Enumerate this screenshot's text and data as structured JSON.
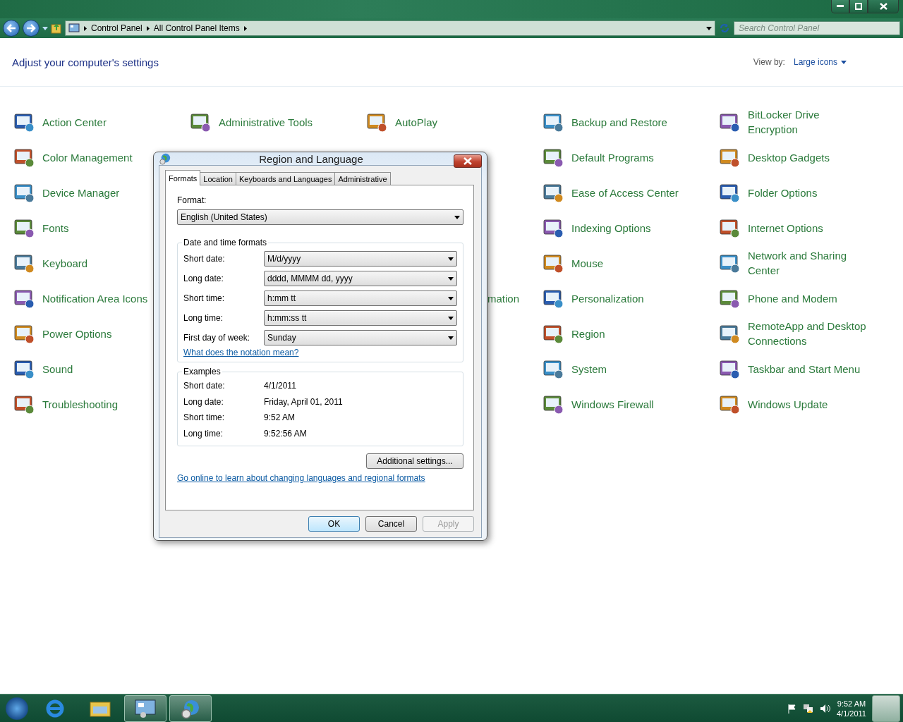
{
  "address_bar": {
    "breadcrumbs": [
      "Control Panel",
      "All Control Panel Items"
    ],
    "search": {
      "placeholder": "Search Control Panel"
    }
  },
  "header": {
    "title": "Adjust your computer's settings",
    "view_by_label": "View by:",
    "view_by_value": "Large icons"
  },
  "items": [
    {
      "kind": "full",
      "label": "Action Center"
    },
    {
      "kind": "full",
      "label": "Administrative Tools"
    },
    {
      "kind": "full",
      "label": "AutoPlay"
    },
    {
      "kind": "full",
      "label": "Backup and Restore"
    },
    {
      "kind": "full",
      "label": "BitLocker Drive Encryption"
    },
    {
      "kind": "full",
      "label": "Color Management"
    },
    {
      "kind": "covered"
    },
    {
      "kind": "covered"
    },
    {
      "kind": "full",
      "label": "Default Programs"
    },
    {
      "kind": "full",
      "label": "Desktop Gadgets"
    },
    {
      "kind": "full",
      "label": "Device Manager"
    },
    {
      "kind": "covered"
    },
    {
      "kind": "covered"
    },
    {
      "kind": "full",
      "label": "Ease of Access Center"
    },
    {
      "kind": "full",
      "label": "Folder Options"
    },
    {
      "kind": "full",
      "label": "Fonts"
    },
    {
      "kind": "covered"
    },
    {
      "kind": "covered"
    },
    {
      "kind": "full",
      "label": "Indexing Options"
    },
    {
      "kind": "full",
      "label": "Internet Options"
    },
    {
      "kind": "full",
      "label": "Keyboard"
    },
    {
      "kind": "covered"
    },
    {
      "kind": "covered"
    },
    {
      "kind": "full",
      "label": "Mouse"
    },
    {
      "kind": "full",
      "label": "Network and Sharing Center"
    },
    {
      "kind": "full",
      "label": "Notification Area Icons"
    },
    {
      "kind": "covered"
    },
    {
      "kind": "cut",
      "label": "mation"
    },
    {
      "kind": "full",
      "label": "Personalization"
    },
    {
      "kind": "full",
      "label": "Phone and Modem"
    },
    {
      "kind": "full",
      "label": "Power Options"
    },
    {
      "kind": "covered"
    },
    {
      "kind": "covered"
    },
    {
      "kind": "full",
      "label": "Region"
    },
    {
      "kind": "full",
      "label": "RemoteApp and Desktop Connections"
    },
    {
      "kind": "full",
      "label": "Sound"
    },
    {
      "kind": "covered"
    },
    {
      "kind": "covered"
    },
    {
      "kind": "full",
      "label": "System"
    },
    {
      "kind": "full",
      "label": "Taskbar and Start Menu"
    },
    {
      "kind": "full",
      "label": "Troubleshooting"
    },
    {
      "kind": "covered"
    },
    {
      "kind": "covered"
    },
    {
      "kind": "full",
      "label": "Windows Firewall"
    },
    {
      "kind": "full",
      "label": "Windows Update"
    }
  ],
  "dialog": {
    "title": "Region and Language",
    "tabs": [
      {
        "label": "Formats",
        "selected": true
      },
      {
        "label": "Location",
        "selected": false
      },
      {
        "label": "Keyboards and Languages",
        "selected": false
      },
      {
        "label": "Administrative",
        "selected": false
      }
    ],
    "format_label": "Format:",
    "format_value": "English (United States)",
    "date_time_group": {
      "title": "Date and time formats",
      "rows": [
        {
          "label": "Short date:",
          "value": "M/d/yyyy"
        },
        {
          "label": "Long date:",
          "value": "dddd, MMMM dd, yyyy"
        },
        {
          "label": "Short time:",
          "value": "h:mm tt"
        },
        {
          "label": "Long time:",
          "value": "h:mm:ss tt"
        },
        {
          "label": "First day of week:",
          "value": "Sunday"
        }
      ]
    },
    "notation_link": "What does the notation mean?",
    "examples": {
      "title": "Examples",
      "rows": [
        {
          "label": "Short date:",
          "value": "4/1/2011"
        },
        {
          "label": "Long date:",
          "value": "Friday, April 01, 2011"
        },
        {
          "label": "Short time:",
          "value": "9:52 AM"
        },
        {
          "label": "Long time:",
          "value": "9:52:56 AM"
        }
      ]
    },
    "additional_button": "Additional settings...",
    "online_link": "Go online to learn about changing languages and regional formats",
    "buttons": [
      {
        "label": "OK",
        "default": true,
        "disabled": false
      },
      {
        "label": "Cancel",
        "default": false,
        "disabled": false
      },
      {
        "label": "Apply",
        "default": false,
        "disabled": true
      }
    ]
  },
  "taskbar": {
    "apps": [
      {
        "open": false
      },
      {
        "open": false
      },
      {
        "open": true
      },
      {
        "open": true
      }
    ],
    "clock": {
      "time": "9:52 AM",
      "date": "4/1/2011"
    }
  }
}
